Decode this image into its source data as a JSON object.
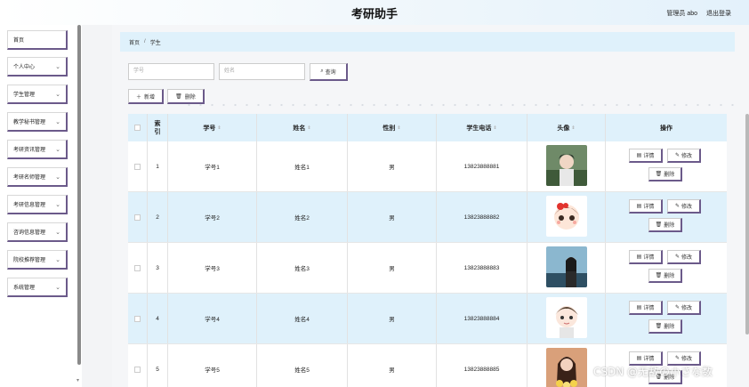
{
  "app": {
    "title": "考研助手",
    "admin": "管理员 abo",
    "logout": "退出登录"
  },
  "sidebar": {
    "items": [
      {
        "label": "首页",
        "chev": ""
      },
      {
        "label": "个人中心",
        "chev": "⌄"
      },
      {
        "label": "学生管理",
        "chev": "⌄"
      },
      {
        "label": "教学秘书管理",
        "chev": "⌄"
      },
      {
        "label": "考研资讯管理",
        "chev": "⌄"
      },
      {
        "label": "考研名师管理",
        "chev": "⌄"
      },
      {
        "label": "考研信息管理",
        "chev": "⌄"
      },
      {
        "label": "咨询信息管理",
        "chev": "⌄"
      },
      {
        "label": "院校推荐管理",
        "chev": "⌄"
      },
      {
        "label": "系统管理",
        "chev": "⌄"
      }
    ]
  },
  "breadcrumb": {
    "home": "首页",
    "sep": "/",
    "current": "学生"
  },
  "search": {
    "student_no_placeholder": "学号",
    "name_placeholder": "姓名",
    "query_label": "查询"
  },
  "actions": {
    "add_label": "新增",
    "delete_label": "删除",
    "add_icon": "plus-icon",
    "delete_icon": "trash-icon"
  },
  "table": {
    "columns": {
      "index": "索引",
      "student_no": "学号",
      "name": "姓名",
      "gender": "性别",
      "phone": "学生电话",
      "avatar": "头像",
      "ops": "操作"
    },
    "sort_glyph": "⇕",
    "op_labels": {
      "detail": "详情",
      "edit": "修改",
      "delete": "删除"
    },
    "rows": [
      {
        "index": "1",
        "student_no": "学号1",
        "name": "姓名1",
        "gender": "男",
        "phone": "13823888881",
        "avatar": "avatar-boy-outdoor"
      },
      {
        "index": "2",
        "student_no": "学号2",
        "name": "姓名2",
        "gender": "男",
        "phone": "13823888882",
        "avatar": "avatar-cartoon-bow"
      },
      {
        "index": "3",
        "student_no": "学号3",
        "name": "姓名3",
        "gender": "男",
        "phone": "13823888883",
        "avatar": "avatar-girl-sky"
      },
      {
        "index": "4",
        "student_no": "学号4",
        "name": "姓名4",
        "gender": "男",
        "phone": "13823888884",
        "avatar": "avatar-cartoon-boy"
      },
      {
        "index": "5",
        "student_no": "学号5",
        "name": "姓名5",
        "gender": "男",
        "phone": "13823888885",
        "avatar": "avatar-girl-flowers"
      }
    ]
  },
  "watermark": "CSDN @无敌の小さな数"
}
